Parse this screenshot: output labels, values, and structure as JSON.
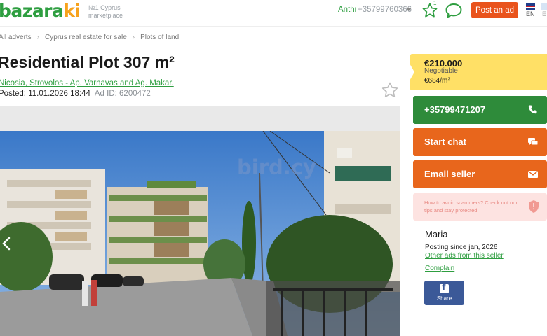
{
  "header": {
    "logo": "bazaraki",
    "tagline": "№1 Cyprus marketplace",
    "user_name": "Anthi",
    "user_phone": "+35799760366",
    "favorites_count": "1",
    "post_ad_label": "Post an ad",
    "language": "EN",
    "language_alt": "E"
  },
  "breadcrumbs": [
    "All adverts",
    "Cyprus real estate for sale",
    "Plots of land"
  ],
  "listing": {
    "title": "Residential Plot 307 m²",
    "address": "Nicosia, Strovolos - Ap. Varnavas and Ag. Makar.",
    "posted": "Posted: 11.01.2026 18:44",
    "ad_id": "Ad ID: 6200472",
    "watermark": "bird.cy"
  },
  "pricing": {
    "price": "€210.000",
    "negotiable": "Negotiable",
    "per_m2": "€684/m²"
  },
  "actions": {
    "phone": "+35799471207",
    "start_chat": "Start chat",
    "email_seller": "Email seller"
  },
  "scam_warning": "How to avoid scammers? Check out our tips and stay protected",
  "seller": {
    "name": "Maria",
    "since": "Posting since jan, 2026",
    "other_ads": "Other ads from this seller",
    "complain": "Complain",
    "share": "Share"
  },
  "colors": {
    "brand_green": "#2e9e40",
    "accent_orange": "#e8661c",
    "price_yellow": "#ffe066",
    "phone_green": "#2e8b3a"
  }
}
